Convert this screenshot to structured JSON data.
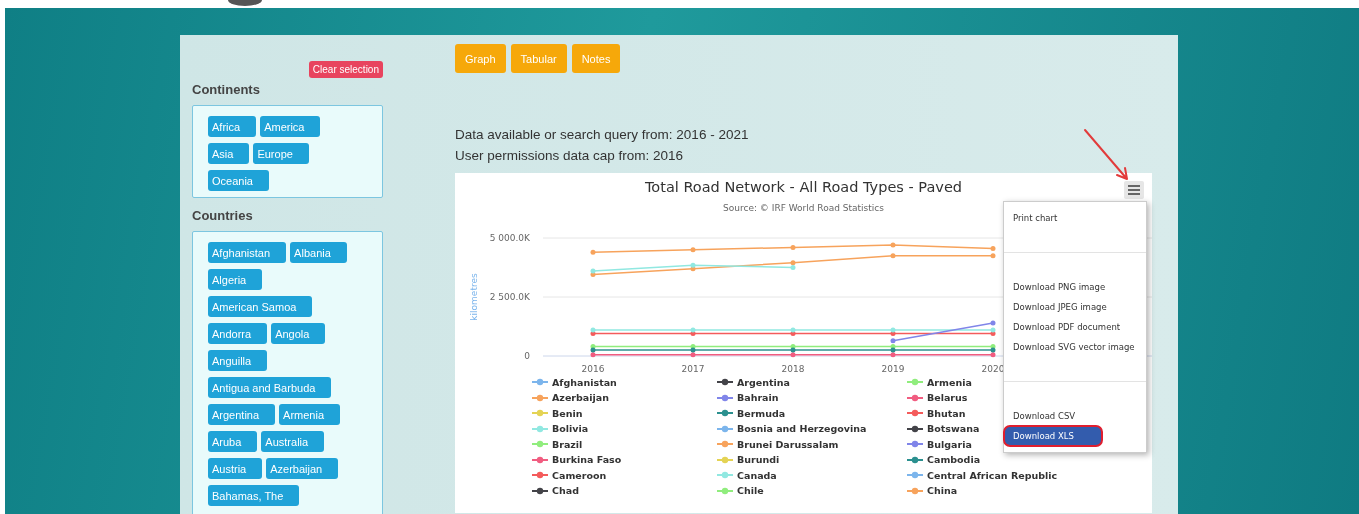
{
  "sidebar": {
    "clear_button": "Clear selection",
    "continents": {
      "heading": "Continents",
      "tags": [
        "Africa",
        "America",
        "Asia",
        "Europe",
        "Oceania"
      ]
    },
    "countries": {
      "heading": "Countries",
      "tags": [
        "Afghanistan",
        "Albania",
        "Algeria",
        "American Samoa",
        "Andorra",
        "Angola",
        "Anguilla",
        "Antigua and Barbuda",
        "Argentina",
        "Armenia",
        "Aruba",
        "Australia",
        "Austria",
        "Azerbaijan",
        "Bahamas, The"
      ]
    }
  },
  "view_buttons": [
    "Graph",
    "Tabular",
    "Notes"
  ],
  "info_lines": [
    "Data available or search query from: 2016 - 2021",
    "User permissions data cap from: 2016"
  ],
  "chart": {
    "chart_data": {
      "type": "line",
      "title": "Total Road Network - All Road Types - Paved",
      "subtitle": "Source: © IRF World Road Statistics",
      "ylabel": "kilometres",
      "categories": [
        "2016",
        "2017",
        "2018",
        "2019",
        "2020"
      ],
      "ylim": [
        0,
        5000
      ],
      "legend": "bottom",
      "yticks": [
        {
          "value": 0,
          "label": "0"
        },
        {
          "value": 2500,
          "label": "2 500.0K"
        },
        {
          "value": 5000,
          "label": "5 000.0K"
        }
      ],
      "series": [
        {
          "name": "Afghanistan",
          "color": "#7cb5ec",
          "marker": true,
          "values": [
            null,
            null,
            null,
            null,
            null
          ]
        },
        {
          "name": "Argentina",
          "color": "#434348",
          "marker": true,
          "values": [
            null,
            null,
            null,
            null,
            null
          ]
        },
        {
          "name": "Armenia",
          "color": "#90ed7d",
          "marker": true,
          "values": [
            null,
            null,
            null,
            null,
            null
          ]
        },
        {
          "name": "Azerbaijan",
          "color": "#f7a35c",
          "marker": true,
          "values": [
            3450,
            3700,
            3950,
            4250,
            4250
          ]
        },
        {
          "name": "Bahrain",
          "color": "#8085e9",
          "marker": true,
          "values": [
            null,
            null,
            null,
            null,
            null
          ]
        },
        {
          "name": "Belarus",
          "color": "#f15c80",
          "marker": true,
          "values": [
            null,
            null,
            null,
            null,
            null
          ]
        },
        {
          "name": "Benin",
          "color": "#e4d354",
          "marker": true,
          "values": [
            null,
            null,
            null,
            null,
            null
          ]
        },
        {
          "name": "Bermuda",
          "color": "#2b908f",
          "marker": true,
          "values": [
            null,
            null,
            null,
            null,
            null
          ]
        },
        {
          "name": "Bhutan",
          "color": "#f45b5b",
          "marker": true,
          "values": [
            950,
            950,
            950,
            950,
            950
          ]
        },
        {
          "name": "Bolivia",
          "color": "#91e8e1",
          "marker": true,
          "values": [
            1100,
            1100,
            1100,
            1100,
            1100
          ]
        },
        {
          "name": "Bosnia and Herzegovina",
          "color": "#7cb5ec",
          "marker": true,
          "values": [
            null,
            null,
            null,
            null,
            null
          ]
        },
        {
          "name": "Botswana",
          "color": "#434348",
          "marker": true,
          "values": [
            null,
            null,
            null,
            null,
            null
          ]
        },
        {
          "name": "Brazil",
          "color": "#90ed7d",
          "marker": true,
          "values": [
            400,
            400,
            400,
            400,
            400
          ]
        },
        {
          "name": "Brunei Darussalam",
          "color": "#f7a35c",
          "marker": true,
          "values": [
            null,
            null,
            null,
            null,
            null
          ]
        },
        {
          "name": "Bulgaria",
          "color": "#8085e9",
          "marker": true,
          "values": [
            null,
            null,
            null,
            650,
            1400
          ]
        },
        {
          "name": "Burkina Faso",
          "color": "#f15c80",
          "marker": true,
          "values": [
            50,
            50,
            50,
            50,
            50
          ]
        },
        {
          "name": "Burundi",
          "color": "#e4d354",
          "marker": true,
          "values": [
            null,
            null,
            null,
            null,
            null
          ]
        },
        {
          "name": "Cambodia",
          "color": "#2b908f",
          "marker": true,
          "values": [
            250,
            250,
            250,
            250,
            250
          ]
        },
        {
          "name": "Cameroon",
          "color": "#f45b5b",
          "marker": true,
          "values": [
            null,
            null,
            null,
            null,
            null
          ]
        },
        {
          "name": "Canada",
          "color": "#91e8e1",
          "marker": true,
          "values": [
            3600,
            3850,
            3750,
            null,
            null
          ]
        },
        {
          "name": "Central African Republic",
          "color": "#7cb5ec",
          "marker": true,
          "values": [
            null,
            null,
            null,
            null,
            null
          ]
        },
        {
          "name": "Chad",
          "color": "#434348",
          "marker": true,
          "values": [
            null,
            null,
            null,
            null,
            null
          ]
        },
        {
          "name": "Chile",
          "color": "#90ed7d",
          "marker": true,
          "values": [
            null,
            null,
            null,
            null,
            null
          ]
        },
        {
          "name": "China",
          "color": "#f7a35c",
          "marker": true,
          "values": [
            4400,
            4500,
            4600,
            4700,
            4550
          ]
        }
      ]
    },
    "menu": [
      {
        "kind": "item",
        "label": "Print chart",
        "selected": false,
        "circled": false
      },
      {
        "kind": "separator"
      },
      {
        "kind": "item",
        "label": "Download PNG image",
        "selected": false,
        "circled": false
      },
      {
        "kind": "item",
        "label": "Download JPEG image",
        "selected": false,
        "circled": false
      },
      {
        "kind": "item",
        "label": "Download PDF document",
        "selected": false,
        "circled": false
      },
      {
        "kind": "item",
        "label": "Download SVG vector image",
        "selected": false,
        "circled": false
      },
      {
        "kind": "separator"
      },
      {
        "kind": "item",
        "label": "Download CSV",
        "selected": false,
        "circled": false
      },
      {
        "kind": "item",
        "label": "Download XLS",
        "selected": true,
        "circled": true
      }
    ]
  }
}
